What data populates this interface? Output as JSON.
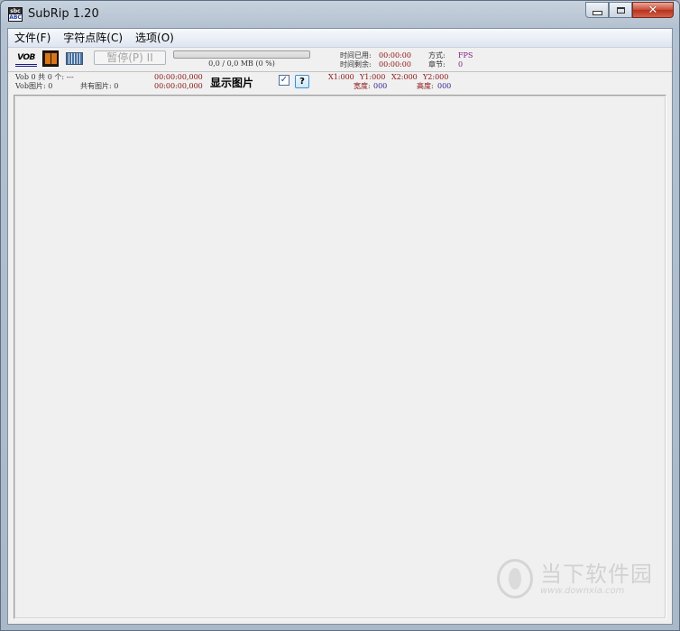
{
  "window": {
    "title": "SubRip 1.20",
    "icon_text": [
      "sbc",
      "ABC",
      "SUBRIP"
    ]
  },
  "menu": [
    {
      "label": "文件(F)"
    },
    {
      "label": "字符点阵(C)"
    },
    {
      "label": "选项(O)"
    }
  ],
  "toolbar": {
    "vob_icon_text": "VOB",
    "pause_label": "暂停(P) II",
    "progress_text": "0,0 / 0,0 MB (0 %)",
    "progress_percent": 0,
    "elapsed_label": "时间已用:",
    "elapsed_value": "00:00:00",
    "remaining_label": "时间剩余:",
    "remaining_value": "00:00:00",
    "mode_label": "方式:",
    "mode_value": "FPS",
    "chapter_label": "章节:",
    "chapter_value": "0"
  },
  "info": {
    "vob_line": "Vob 0 共 0 个: ---",
    "vob_images_line": "Vob图片: 0",
    "total_images_line": "共有图片: 0",
    "time1": "00:00:00,000",
    "time2": "00:00:00,000",
    "show_image_label": "显示图片",
    "checkbox_mark": "✓",
    "help_label": "?",
    "x1": "X1:000",
    "y1": "Y1:000",
    "x2": "X2:000",
    "y2": "Y2:000",
    "width_label": "宽度:",
    "width_value": "000",
    "height_label": "高度:",
    "height_value": "000"
  },
  "watermark": {
    "text": "当下软件园",
    "url": "www.downxia.com"
  },
  "colors": {
    "label_red": "#8b1010",
    "label_purple": "#7a1a7a",
    "value_blue": "#33228a"
  }
}
